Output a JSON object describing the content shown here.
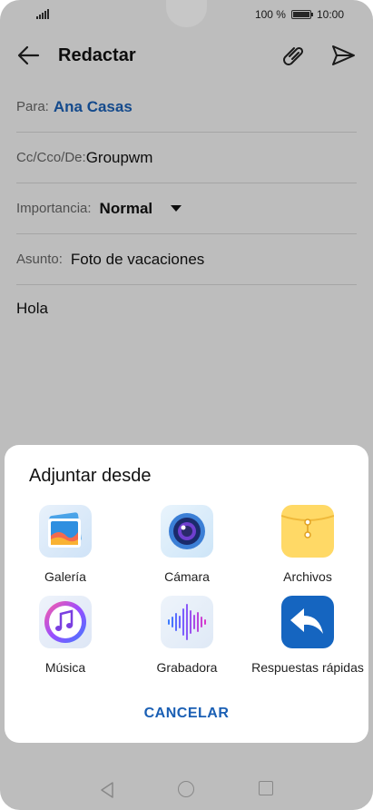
{
  "status": {
    "battery": "100 %",
    "time": "10:00",
    "battery_level": 1.0
  },
  "toolbar": {
    "title": "Redactar",
    "back_icon": "arrow-left-icon",
    "attach_icon": "paperclip-icon",
    "send_icon": "send-icon"
  },
  "form": {
    "to_label": "Para:",
    "to_value": "Ana Casas",
    "cc_label": "Cc/Cco/De:",
    "cc_value": "Groupwm",
    "importance_label": "Importancia:",
    "importance_value": "Normal",
    "subject_label": "Asunto:",
    "subject_value": "Foto de vacaciones",
    "body": "Hola"
  },
  "sheet": {
    "title": "Adjuntar desde",
    "options": [
      {
        "label": "Galería",
        "icon": "gallery-icon"
      },
      {
        "label": "Cámara",
        "icon": "camera-icon"
      },
      {
        "label": "Archivos",
        "icon": "files-icon"
      },
      {
        "label": "Música",
        "icon": "music-icon"
      },
      {
        "label": "Grabadora",
        "icon": "recorder-icon"
      },
      {
        "label": "Respuestas rápidas",
        "icon": "quick-reply-icon"
      }
    ],
    "cancel": "CANCELAR"
  },
  "colors": {
    "accent": "#1a5fb4",
    "scrim": "rgba(0,0,0,0.22)"
  }
}
